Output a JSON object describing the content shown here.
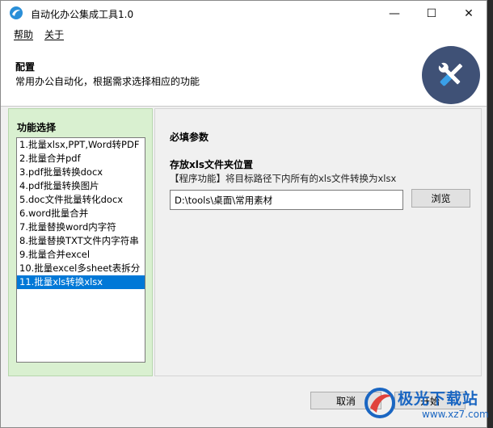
{
  "window": {
    "title": "自动化办公集成工具1.0",
    "min_glyph": "—",
    "max_glyph": "☐",
    "close_glyph": "✕"
  },
  "menu": {
    "help": "帮助",
    "about": "关于"
  },
  "header": {
    "title": "配置",
    "subtitle": "常用办公自动化，根据需求选择相应的功能",
    "logo_icon": "tools-icon",
    "logo_color": "#3f5176"
  },
  "function_panel": {
    "title": "功能选择",
    "items": [
      "1.批量xlsx,PPT,Word转PDF",
      "2.批量合并pdf",
      "3.pdf批量转换docx",
      "4.pdf批量转换图片",
      "5.doc文件批量转化docx",
      "6.word批量合并",
      "7.批量替换word内字符",
      "8.批量替换TXT文件内字符串",
      "9.批量合并excel",
      "10.批量excel多sheet表拆分",
      "11.批量xls转换xlsx"
    ],
    "selected_index": 10
  },
  "params": {
    "section_title": "必填参数",
    "label": "存放xls文件夹位置",
    "description": "【程序功能】将目标路径下内所有的xls文件转换为xlsx",
    "path_value": "D:\\tools\\桌面\\常用素材",
    "browse_label": "浏览"
  },
  "buttons": {
    "cancel": "取消",
    "start": "开始"
  },
  "watermark": {
    "text": "极光下载站",
    "url": "www.xz7.com"
  },
  "colors": {
    "selection": "#0078d7",
    "left_panel_bg": "#d9f0d0",
    "accent": "#1a66c2"
  }
}
